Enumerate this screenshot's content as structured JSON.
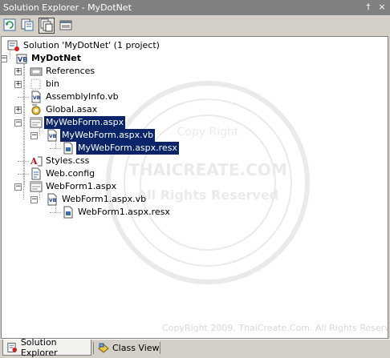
{
  "window": {
    "title": "Solution Explorer - MyDotNet"
  },
  "titlebar_buttons": [
    {
      "icon": "pin-icon",
      "glyph": "†"
    },
    {
      "icon": "close-icon",
      "glyph": "×"
    }
  ],
  "toolbar": {
    "buttons": [
      {
        "icon": "refresh-icon"
      },
      {
        "icon": "view-code-icon"
      },
      {
        "icon": "show-all-files-icon",
        "pressed": true
      },
      {
        "icon": "properties-icon"
      }
    ]
  },
  "tree": {
    "items": [
      {
        "label": "Solution 'MyDotNet' (1 project)",
        "icon": "solution-icon",
        "level": 0,
        "expander": "none"
      },
      {
        "label": "MyDotNet",
        "icon": "vb-project-icon",
        "level": 1,
        "expander": "minus",
        "bold": true
      },
      {
        "label": "References",
        "icon": "references-icon",
        "level": 2,
        "expander": "plus"
      },
      {
        "label": "bin",
        "icon": "folder-icon",
        "level": 2,
        "expander": "plus"
      },
      {
        "label": "AssemblyInfo.vb",
        "icon": "vb-file-icon",
        "level": 2,
        "expander": "none"
      },
      {
        "label": "Global.asax",
        "icon": "global-asax-icon",
        "level": 2,
        "expander": "plus"
      },
      {
        "label": "MyWebForm.aspx",
        "icon": "webform-icon",
        "level": 2,
        "expander": "minus",
        "selected": true
      },
      {
        "label": "MyWebForm.aspx.vb",
        "icon": "vb-file-icon",
        "level": 3,
        "expander": "minus",
        "selected": true
      },
      {
        "label": "MyWebForm.aspx.resx",
        "icon": "resx-icon",
        "level": 4,
        "expander": "none",
        "selected": true
      },
      {
        "label": "Styles.css",
        "icon": "css-icon",
        "level": 2,
        "expander": "none"
      },
      {
        "label": "Web.config",
        "icon": "config-icon",
        "level": 2,
        "expander": "none"
      },
      {
        "label": "WebForm1.aspx",
        "icon": "webform-icon",
        "level": 2,
        "expander": "minus"
      },
      {
        "label": "WebForm1.aspx.vb",
        "icon": "vb-file-icon",
        "level": 3,
        "expander": "minus"
      },
      {
        "label": "WebForm1.aspx.resx",
        "icon": "resx-icon",
        "level": 4,
        "expander": "none"
      }
    ]
  },
  "watermark": {
    "text": "THAICREATE.COM",
    "line1": "Copy Right",
    "line2": "All Rights Reserved",
    "copyright": "CopyRight 2009, ThaiCreate.Com. All Rights Reserved."
  },
  "tabs": [
    {
      "label": "Solution Explorer",
      "icon": "solution-explorer-tab-icon",
      "active": true
    },
    {
      "label": "Class View",
      "icon": "class-view-tab-icon",
      "active": false
    }
  ]
}
